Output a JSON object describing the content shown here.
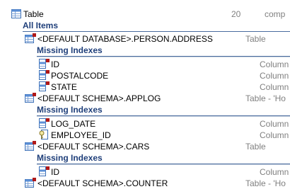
{
  "top": {
    "label": "Table",
    "count": "20",
    "extra": "comp"
  },
  "all_items_header": "All Items",
  "tables": [
    {
      "name": "<DEFAULT DATABASE>.PERSON.ADDRESS",
      "type": "Table",
      "section": "Missing Indexes",
      "columns": [
        {
          "name": "ID",
          "type": "Column",
          "icon": "column-icon"
        },
        {
          "name": "POSTALCODE",
          "type": "Column",
          "icon": "column-icon"
        },
        {
          "name": "STATE",
          "type": "Column",
          "icon": "column-icon"
        }
      ]
    },
    {
      "name": "<DEFAULT SCHEMA>.APPLOG",
      "type": "Table - 'Ho",
      "section": "Missing Indexes",
      "columns": [
        {
          "name": "LOG_DATE",
          "type": "Column",
          "icon": "column-icon"
        },
        {
          "name": "EMPLOYEE_ID",
          "type": "Column",
          "icon": "key-column-icon"
        }
      ]
    },
    {
      "name": "<DEFAULT SCHEMA>.CARS",
      "type": "Table",
      "section": "Missing Indexes",
      "columns": [
        {
          "name": "ID",
          "type": "Column",
          "icon": "column-icon"
        }
      ]
    },
    {
      "name": "<DEFAULT SCHEMA>.COUNTER",
      "type": "Table - 'Ho",
      "section": "",
      "columns": []
    }
  ]
}
